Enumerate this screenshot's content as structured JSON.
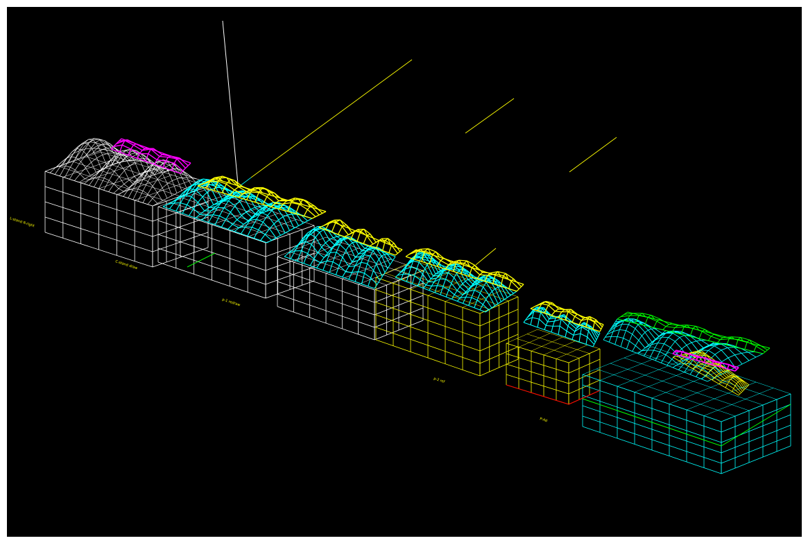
{
  "viewport": {
    "background": "#000000"
  },
  "colors": {
    "white": "#ffffff",
    "cyan": "#00ffff",
    "yellow": "#ffff00",
    "magenta": "#ff00ff",
    "green": "#00ff00",
    "red": "#ff0000"
  },
  "labels": [
    {
      "id": "label-1",
      "text": "L-stand R-right"
    },
    {
      "id": "label-2",
      "text": "C-stand draw"
    },
    {
      "id": "label-3",
      "text": "p-1 redraw"
    },
    {
      "id": "label-4",
      "text": "p-2 ref"
    },
    {
      "id": "label-5",
      "text": "P-Ad"
    }
  ]
}
